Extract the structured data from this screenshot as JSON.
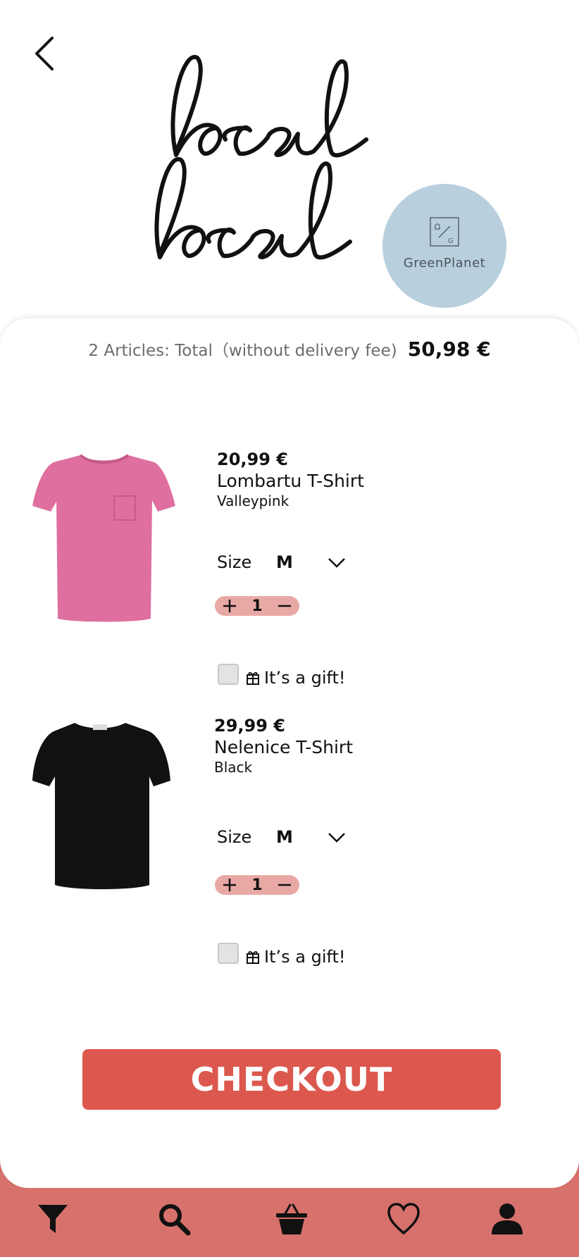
{
  "header": {
    "back_icon": "chevron-left-icon",
    "logo_text": "local local",
    "store": {
      "name": "GreenPlanet",
      "icon": "store-logo-mark",
      "color": "#b8cfdd"
    }
  },
  "cart": {
    "summary_label": "2 Articles: Total（without delivery fee)",
    "total": "50,98 €",
    "items": [
      {
        "price": "20,99 €",
        "name": "Lombartu T-Shirt",
        "color": "Valleypink",
        "size_label": "Size",
        "size": "M",
        "quantity": "1",
        "gift_label": "It’s a gift!",
        "gift_checked": false,
        "image": "pink-tshirt",
        "image_color": "#df6f9e"
      },
      {
        "price": "29,99 €",
        "name": "Nelenice T-Shirt",
        "color": "Black",
        "size_label": "Size",
        "size": "M",
        "quantity": "1",
        "gift_label": "It’s a gift!",
        "gift_checked": false,
        "image": "black-tshirt",
        "image_color": "#111111"
      }
    ]
  },
  "checkout_label": "CHECKOUT",
  "nav": {
    "items": [
      "filter-icon",
      "search-icon",
      "basket-icon",
      "heart-icon",
      "user-icon"
    ]
  },
  "colors": {
    "accent": "#dc584e",
    "nav_background": "#d7716c",
    "stepper_background": "#e8a9a5"
  }
}
